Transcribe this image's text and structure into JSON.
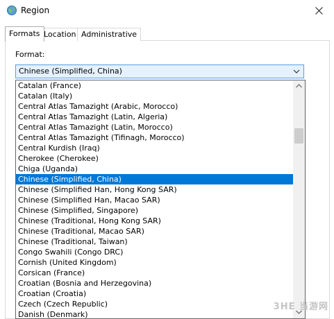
{
  "window": {
    "title": "Region",
    "icon": "region-globe-icon",
    "close_icon": "close-icon"
  },
  "tabs": [
    {
      "label": "Formats",
      "active": true
    },
    {
      "label": "Location",
      "active": false
    },
    {
      "label": "Administrative",
      "active": false
    }
  ],
  "format": {
    "label": "Format:",
    "selected": "Chinese (Simplified, China)"
  },
  "dropdown": {
    "items": [
      "Catalan (France)",
      "Catalan (Italy)",
      "Central Atlas Tamazight (Arabic, Morocco)",
      "Central Atlas Tamazight (Latin, Algeria)",
      "Central Atlas Tamazight (Latin, Morocco)",
      "Central Atlas Tamazight (Tifinagh, Morocco)",
      "Central Kurdish (Iraq)",
      "Cherokee (Cherokee)",
      "Chiga (Uganda)",
      "Chinese (Simplified, China)",
      "Chinese (Simplified Han, Hong Kong SAR)",
      "Chinese (Simplified Han, Macao SAR)",
      "Chinese (Simplified, Singapore)",
      "Chinese (Traditional, Hong Kong SAR)",
      "Chinese (Traditional, Macao SAR)",
      "Chinese (Traditional, Taiwan)",
      "Congo Swahili (Congo DRC)",
      "Cornish (United Kingdom)",
      "Corsican (France)",
      "Croatian (Bosnia and Herzegovina)",
      "Croatian (Croatia)",
      "Czech (Czech Republic)",
      "Danish (Denmark)"
    ],
    "selected_index": 9
  },
  "watermark": "3HE 当游网",
  "colors": {
    "selection": "#0078d7",
    "combo_border": "#569de5",
    "combo_bg": "#e5f1fb"
  }
}
